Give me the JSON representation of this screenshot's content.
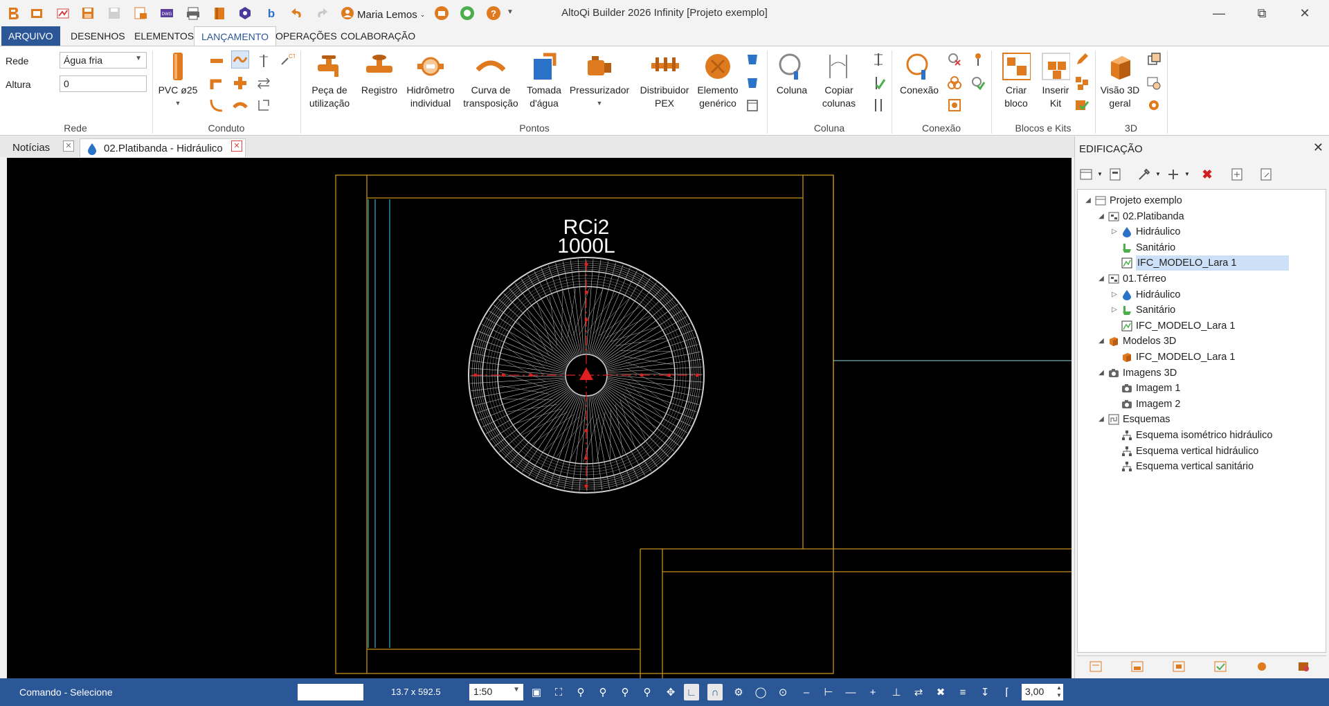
{
  "window": {
    "title": "AltoQi Builder 2026 Infinity [Projeto exemplo]",
    "user": "Maria Lemos"
  },
  "menu": {
    "tabs": [
      "ARQUIVO",
      "DESENHOS",
      "ELEMENTOS",
      "LANÇAMENTO",
      "OPERAÇÕES",
      "COLABORAÇÃO"
    ],
    "active": "LANÇAMENTO"
  },
  "ribbon": {
    "rede": {
      "group": "Rede",
      "rede_label": "Rede",
      "rede_value": "Água fria",
      "altura_label": "Altura",
      "altura_value": "0"
    },
    "conduto": {
      "group": "Conduto",
      "pipe": "PVC ø25"
    },
    "pontos": {
      "group": "Pontos",
      "items": [
        [
          "Peça de",
          "utilização"
        ],
        [
          "Registro",
          ""
        ],
        [
          "Hidrômetro",
          "individual"
        ],
        [
          "Curva de",
          "transposição"
        ],
        [
          "Tomada",
          "d'água"
        ],
        [
          "Pressurizador",
          ""
        ],
        [
          "Distribuidor",
          "PEX"
        ],
        [
          "Elemento",
          "genérico"
        ]
      ]
    },
    "coluna": {
      "group": "Coluna",
      "items": [
        [
          "Coluna",
          ""
        ],
        [
          "Copiar",
          "colunas"
        ]
      ]
    },
    "conexao": {
      "group": "Conexão",
      "items": [
        [
          "Conexão",
          ""
        ]
      ]
    },
    "blocos": {
      "group": "Blocos e Kits",
      "items": [
        [
          "Criar",
          "bloco"
        ],
        [
          "Inserir",
          "Kit"
        ]
      ]
    },
    "three_d": {
      "group": "3D",
      "items": [
        [
          "Visão 3D",
          "geral"
        ]
      ]
    }
  },
  "doc_tabs": [
    {
      "label": "Notícias"
    },
    {
      "label": "02.Platibanda - Hidráulico"
    }
  ],
  "drawing": {
    "tank_name": "RCi2",
    "tank_volume": "1000L"
  },
  "panel": {
    "title": "EDIFICAÇÃO",
    "tree": [
      {
        "label": "Projeto exemplo",
        "level": 0,
        "twisty": "open",
        "icon": "project-icon"
      },
      {
        "label": "02.Platibanda",
        "level": 1,
        "twisty": "open",
        "icon": "floor-icon"
      },
      {
        "label": "Hidráulico",
        "level": 2,
        "twisty": "closed",
        "icon": "water-drop-icon"
      },
      {
        "label": "Sanitário",
        "level": 2,
        "twisty": "none",
        "icon": "sanitary-icon"
      },
      {
        "label": "IFC_MODELO_Lara 1",
        "level": 2,
        "twisty": "none",
        "icon": "ifc-icon",
        "selected": true
      },
      {
        "label": "01.Térreo",
        "level": 1,
        "twisty": "open",
        "icon": "floor-icon"
      },
      {
        "label": "Hidráulico",
        "level": 2,
        "twisty": "closed",
        "icon": "water-drop-icon"
      },
      {
        "label": "Sanitário",
        "level": 2,
        "twisty": "closed",
        "icon": "sanitary-icon"
      },
      {
        "label": "IFC_MODELO_Lara 1",
        "level": 2,
        "twisty": "none",
        "icon": "ifc-icon"
      },
      {
        "label": "Modelos 3D",
        "level": 1,
        "twisty": "open",
        "icon": "model3d-icon"
      },
      {
        "label": "IFC_MODELO_Lara 1",
        "level": 2,
        "twisty": "none",
        "icon": "model3d-icon"
      },
      {
        "label": "Imagens 3D",
        "level": 1,
        "twisty": "open",
        "icon": "camera-icon"
      },
      {
        "label": "Imagem 1",
        "level": 2,
        "twisty": "none",
        "icon": "camera-icon"
      },
      {
        "label": "Imagem 2",
        "level": 2,
        "twisty": "none",
        "icon": "camera-icon"
      },
      {
        "label": "Esquemas",
        "level": 1,
        "twisty": "open",
        "icon": "schema-icon"
      },
      {
        "label": "Esquema isométrico hidráulico",
        "level": 2,
        "twisty": "none",
        "icon": "hierarchy-icon"
      },
      {
        "label": "Esquema vertical hidráulico",
        "level": 2,
        "twisty": "none",
        "icon": "hierarchy-icon"
      },
      {
        "label": "Esquema vertical sanitário",
        "level": 2,
        "twisty": "none",
        "icon": "hierarchy-icon"
      }
    ]
  },
  "status": {
    "command": "Comando - Selecione",
    "coords": "13.7 x 592.5",
    "scale": "1:50",
    "zoom_value": "3,00"
  },
  "colors": {
    "accent": "#2b5797",
    "canvas": "#000000",
    "wall": "#c8901e",
    "pipe": "#2ea0c8",
    "marker": "#e02020"
  }
}
